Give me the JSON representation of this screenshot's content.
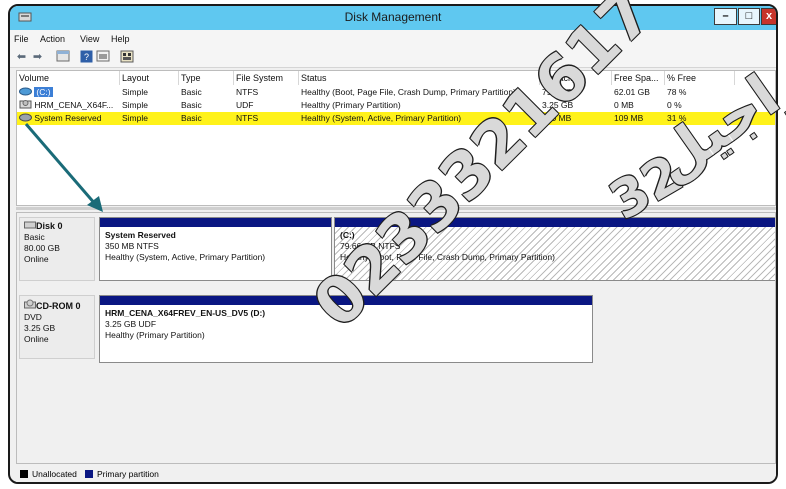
{
  "window": {
    "title": "Disk Management"
  },
  "menu": [
    "File",
    "Action",
    "View",
    "Help"
  ],
  "volume_table": {
    "columns": [
      "Volume",
      "Layout",
      "Type",
      "File System",
      "Status",
      "Capacity",
      "Free Spa...",
      "% Free"
    ],
    "rows": [
      [
        "(C:)",
        "Simple",
        "Basic",
        "NTFS",
        "Healthy (Boot, Page File, Crash Dump, Primary Partition)",
        "79.66 GB",
        "62.01 GB",
        "78 %"
      ],
      [
        "HRM_CENA_X64F...",
        "Simple",
        "Basic",
        "UDF",
        "Healthy (Primary Partition)",
        "3.25 GB",
        "0 MB",
        "0 %"
      ],
      [
        "System Reserved",
        "Simple",
        "Basic",
        "NTFS",
        "Healthy (System, Active, Primary Partition)",
        "350 MB",
        "109 MB",
        "31 %"
      ]
    ],
    "selected_row": 2
  },
  "disks": [
    {
      "name": "Disk 0",
      "type": "Basic",
      "size": "80.00 GB",
      "state": "Online",
      "partitions": [
        {
          "name": "System Reserved",
          "size": "350 MB NTFS",
          "status": "Healthy (System, Active, Primary Partition)"
        },
        {
          "name": "(C:)",
          "size": "79.66 GB NTFS",
          "status": "Healthy (Boot, Page File, Crash Dump, Primary Partition)"
        }
      ]
    },
    {
      "name": "CD-ROM 0",
      "type": "DVD",
      "size": "3.25 GB",
      "state": "Online",
      "partitions": [
        {
          "name": "HRM_CENA_X64FREV_EN-US_DV5  (D:)",
          "size": "3.25 GB UDF",
          "status": "Healthy (Primary Partition)"
        }
      ]
    }
  ],
  "legend": [
    {
      "label": "Unallocated",
      "color": "#000000"
    },
    {
      "label": "Primary partition",
      "color": "#0a1682"
    }
  ],
  "watermark": {
    "number": "0233321617",
    "number_tail": "32",
    "arabic": "راجيل"
  }
}
